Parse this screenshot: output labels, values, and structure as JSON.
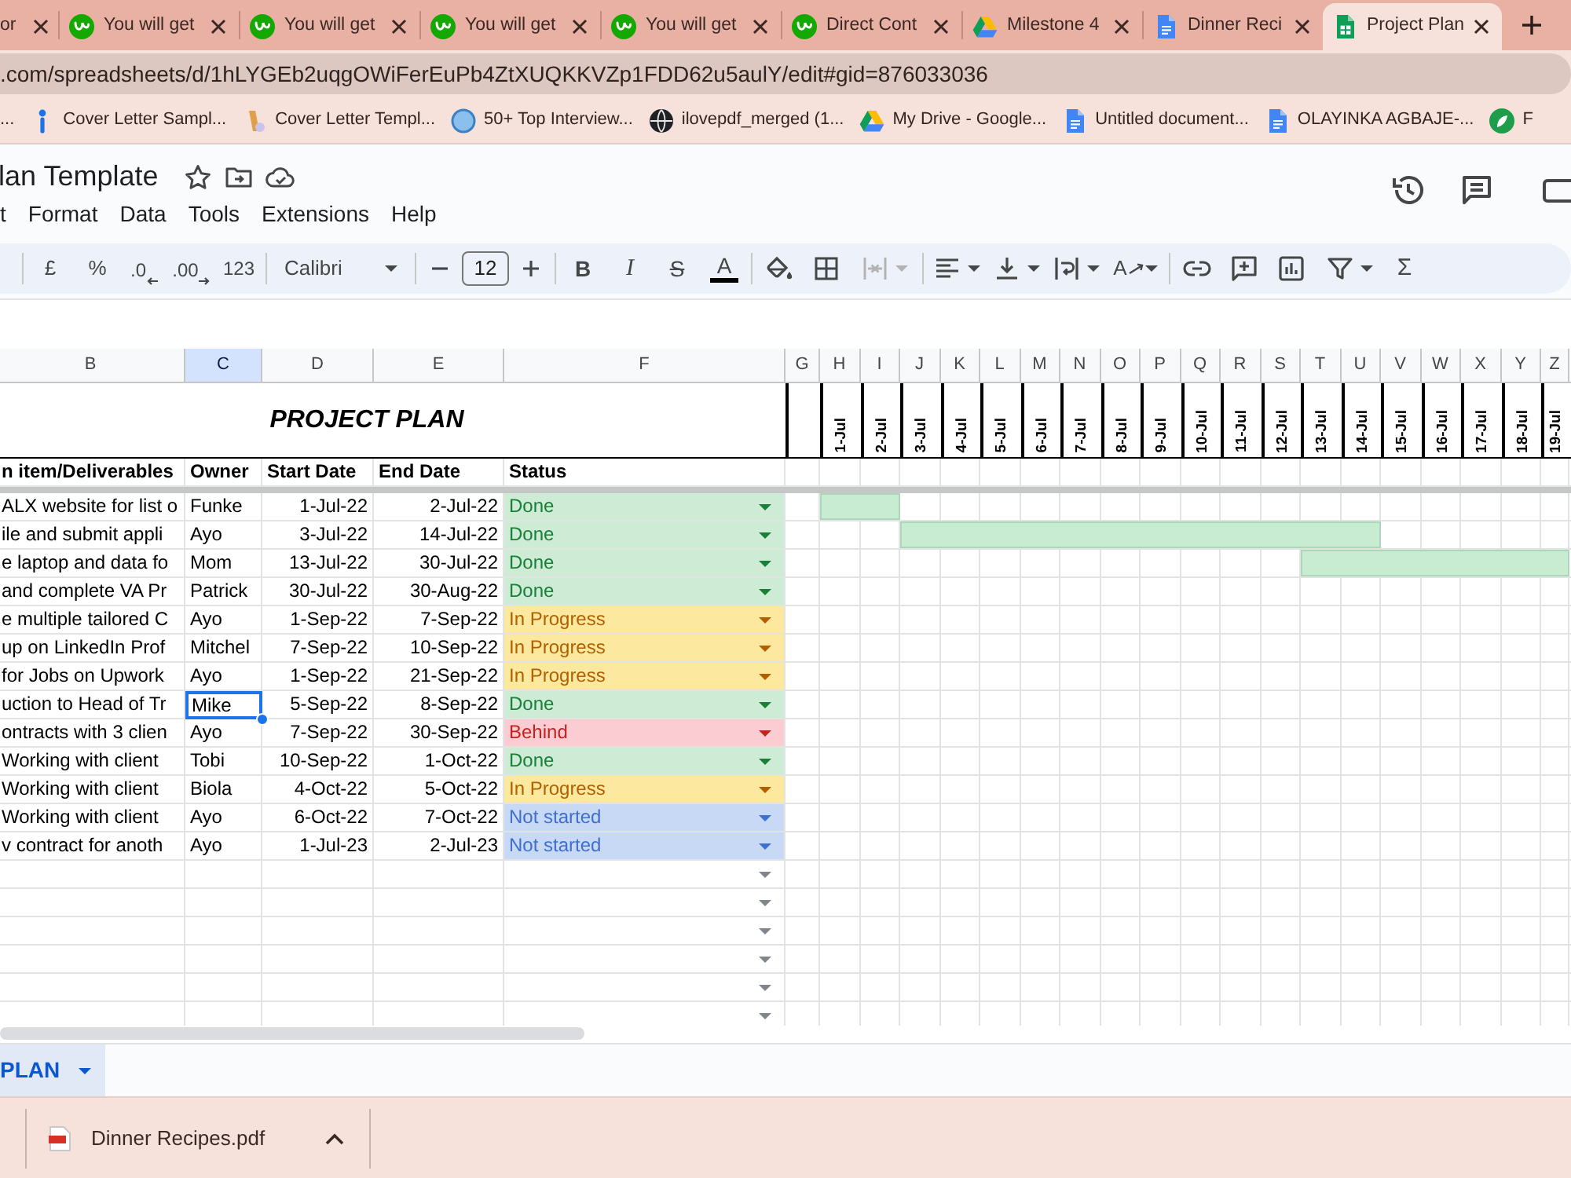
{
  "browser": {
    "tabs": [
      {
        "title": "or",
        "kind": "plain",
        "selected": false
      },
      {
        "title": "You will get",
        "kind": "circle",
        "selected": false
      },
      {
        "title": "You will get",
        "kind": "circle",
        "selected": false
      },
      {
        "title": "You will get",
        "kind": "circle",
        "selected": false
      },
      {
        "title": "You will get",
        "kind": "circle",
        "selected": false
      },
      {
        "title": "Direct Cont",
        "kind": "circle",
        "selected": false
      },
      {
        "title": "Milestone 4",
        "kind": "triangle",
        "selected": false
      },
      {
        "title": "Dinner Reci",
        "kind": "page",
        "selected": false
      },
      {
        "title": "Project Plan",
        "kind": "grid",
        "selected": true
      }
    ],
    "address": ".com/spreadsheets/d/1hLYGEb2uqgOWiFerEuPb4ZtXUQKKVZp1FDD62u5aulY/edit#gid=876033036",
    "bookmarks": [
      {
        "label": "...",
        "kind": "plain"
      },
      {
        "label": "Cover Letter Sampl...",
        "kind": "pin"
      },
      {
        "label": "Cover Letter Templ...",
        "kind": "figure"
      },
      {
        "label": "50+ Top Interview...",
        "kind": "disc"
      },
      {
        "label": "ilovepdf_merged (1...",
        "kind": "globe"
      },
      {
        "label": "My Drive - Google...",
        "kind": "triangle"
      },
      {
        "label": "Untitled document...",
        "kind": "page"
      },
      {
        "label": "OLAYINKA AGBAJE-...",
        "kind": "page"
      },
      {
        "label": "F",
        "kind": "leaf"
      }
    ]
  },
  "document": {
    "title": "lan Template",
    "menus": [
      "t",
      "Format",
      "Data",
      "Tools",
      "Extensions",
      "Help"
    ]
  },
  "toolbar": {
    "currency": "£",
    "percent": "%",
    "decrease_decimals": ".0",
    "increase_decimals": ".00",
    "number_formats": "123",
    "font": "Calibri",
    "font_size": "12",
    "bold": "B",
    "italic": "I",
    "strikethrough": "S",
    "text_color": "A",
    "text_rotation": "A",
    "functions": "Σ",
    "merge_cells": {
      "disabled": true
    }
  },
  "sheet": {
    "columns": [
      {
        "label": "B",
        "selected": false
      },
      {
        "label": "C",
        "selected": true
      },
      {
        "label": "D",
        "selected": false
      },
      {
        "label": "E",
        "selected": false
      },
      {
        "label": "F",
        "selected": false
      },
      {
        "label": "G",
        "selected": false
      },
      {
        "label": "H",
        "selected": false
      },
      {
        "label": "I",
        "selected": false
      },
      {
        "label": "J",
        "selected": false
      },
      {
        "label": "K",
        "selected": false
      },
      {
        "label": "L",
        "selected": false
      },
      {
        "label": "M",
        "selected": false
      },
      {
        "label": "N",
        "selected": false
      },
      {
        "label": "O",
        "selected": false
      },
      {
        "label": "P",
        "selected": false
      },
      {
        "label": "Q",
        "selected": false
      },
      {
        "label": "R",
        "selected": false
      },
      {
        "label": "S",
        "selected": false
      },
      {
        "label": "T",
        "selected": false
      },
      {
        "label": "U",
        "selected": false
      },
      {
        "label": "V",
        "selected": false
      },
      {
        "label": "W",
        "selected": false
      },
      {
        "label": "X",
        "selected": false
      },
      {
        "label": "Y",
        "selected": false
      },
      {
        "label": "Z",
        "selected": false
      }
    ],
    "title": "PROJECT PLAN",
    "timeline": [
      "1-Jul",
      "2-Jul",
      "3-Jul",
      "4-Jul",
      "5-Jul",
      "6-Jul",
      "7-Jul",
      "8-Jul",
      "9-Jul",
      "10-Jul",
      "11-Jul",
      "12-Jul",
      "13-Jul",
      "14-Jul",
      "15-Jul",
      "16-Jul",
      "17-Jul",
      "18-Jul",
      "19-Jul"
    ],
    "headers": [
      "n item/Deliverables",
      "Owner",
      "Start Date",
      "End Date",
      "Status"
    ],
    "rows": [
      {
        "task": "ALX website for list o",
        "owner": {
          "text": "Funke",
          "selected": false
        },
        "start": "1-Jul-22",
        "end": "2-Jul-22",
        "status": {
          "text": "Done",
          "kind": "done"
        }
      },
      {
        "task": "ile and submit appli",
        "owner": {
          "text": "Ayo",
          "selected": false
        },
        "start": "3-Jul-22",
        "end": "14-Jul-22",
        "status": {
          "text": "Done",
          "kind": "done"
        }
      },
      {
        "task": "e laptop and data fo",
        "owner": {
          "text": "Mom",
          "selected": false
        },
        "start": "13-Jul-22",
        "end": "30-Jul-22",
        "status": {
          "text": "Done",
          "kind": "done"
        }
      },
      {
        "task": "and complete VA Pr",
        "owner": {
          "text": "Patrick",
          "selected": false
        },
        "start": "30-Jul-22",
        "end": "30-Aug-22",
        "status": {
          "text": "Done",
          "kind": "done"
        }
      },
      {
        "task": "e multiple tailored C",
        "owner": {
          "text": "Ayo",
          "selected": false
        },
        "start": "1-Sep-22",
        "end": "7-Sep-22",
        "status": {
          "text": "In Progress",
          "kind": "in_progress"
        }
      },
      {
        "task": "up on LinkedIn Prof",
        "owner": {
          "text": "Mitchel",
          "selected": false
        },
        "start": "7-Sep-22",
        "end": "10-Sep-22",
        "status": {
          "text": "In Progress",
          "kind": "in_progress"
        }
      },
      {
        "task": "for Jobs on Upwork",
        "owner": {
          "text": "Ayo",
          "selected": false
        },
        "start": "1-Sep-22",
        "end": "21-Sep-22",
        "status": {
          "text": "In Progress",
          "kind": "in_progress"
        }
      },
      {
        "task": "uction to Head of Tr",
        "owner": {
          "text": "Mike",
          "selected": true
        },
        "start": "5-Sep-22",
        "end": "8-Sep-22",
        "status": {
          "text": "Done",
          "kind": "done"
        }
      },
      {
        "task": "ontracts with 3 clien",
        "owner": {
          "text": "Ayo",
          "selected": false
        },
        "start": "7-Sep-22",
        "end": "30-Sep-22",
        "status": {
          "text": "Behind",
          "kind": "behind"
        }
      },
      {
        "task": "Working with client",
        "owner": {
          "text": "Tobi",
          "selected": false
        },
        "start": "10-Sep-22",
        "end": "1-Oct-22",
        "status": {
          "text": "Done",
          "kind": "done"
        }
      },
      {
        "task": "Working with client",
        "owner": {
          "text": "Biola",
          "selected": false
        },
        "start": "4-Oct-22",
        "end": "5-Oct-22",
        "status": {
          "text": "In Progress",
          "kind": "in_progress"
        }
      },
      {
        "task": "Working with client",
        "owner": {
          "text": "Ayo",
          "selected": false
        },
        "start": "6-Oct-22",
        "end": "7-Oct-22",
        "status": {
          "text": "Not started",
          "kind": "not_started"
        }
      },
      {
        "task": "v contract for anoth",
        "owner": {
          "text": "Ayo",
          "selected": false
        },
        "start": "1-Jul-23",
        "end": "2-Jul-23",
        "status": {
          "text": "Not started",
          "kind": "not_started"
        }
      }
    ],
    "blank_rows": [
      {
        "dropdown": true
      },
      {
        "dropdown": true
      },
      {
        "dropdown": true
      },
      {
        "dropdown": true
      },
      {
        "dropdown": true
      },
      {
        "dropdown": true
      }
    ]
  },
  "sheet_tabs": [
    {
      "label": "PLAN",
      "selected": true
    }
  ],
  "downloads": [
    {
      "file": "Dinner Recipes.pdf"
    }
  ]
}
